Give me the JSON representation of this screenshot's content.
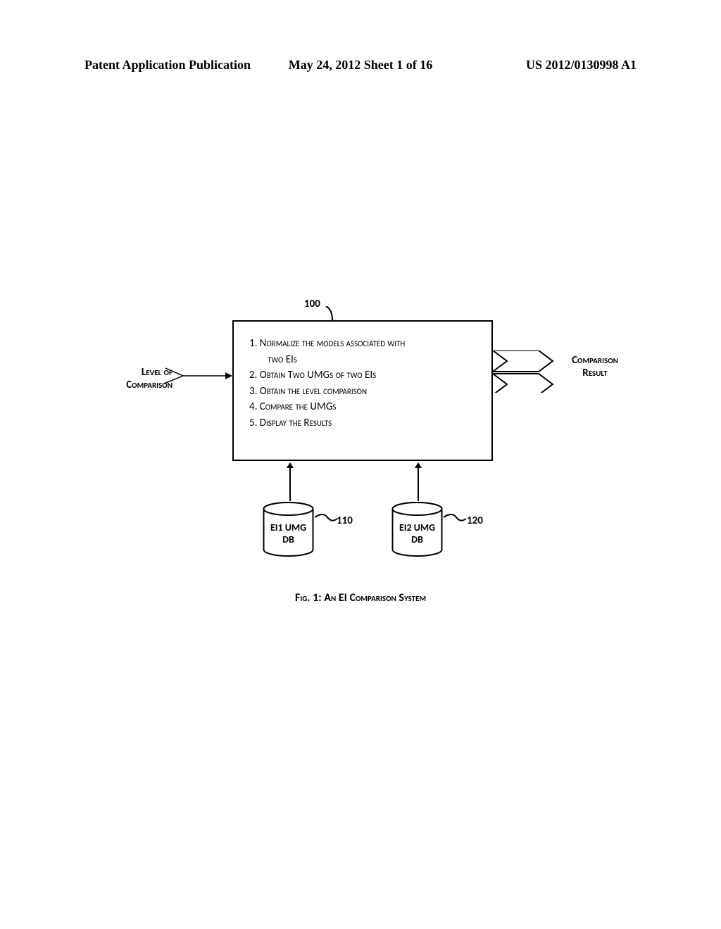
{
  "header": {
    "left": "Patent Application Publication",
    "center": "May 24, 2012  Sheet 1 of 16",
    "right": "US 2012/0130998 A1"
  },
  "refs": {
    "r100": "100",
    "r110": "110",
    "r120": "120"
  },
  "labels": {
    "left_line1": "Level of",
    "left_line2": "Comparison",
    "right_line1": "Comparison",
    "right_line2": "Result"
  },
  "steps": {
    "s1a": "1. Normalize the models associated with",
    "s1b": "two EIs",
    "s2": "2. Obtain Two UMGs of two EIs",
    "s3": "3. Obtain the level comparison",
    "s4": "4. Compare the UMGs",
    "s5": "5. Display the Results"
  },
  "db": {
    "d1_l1": "EI1 UMG",
    "d1_l2": "DB",
    "d2_l1": "EI2 UMG",
    "d2_l2": "DB"
  },
  "caption": "Fig. 1: An EI Comparison System"
}
